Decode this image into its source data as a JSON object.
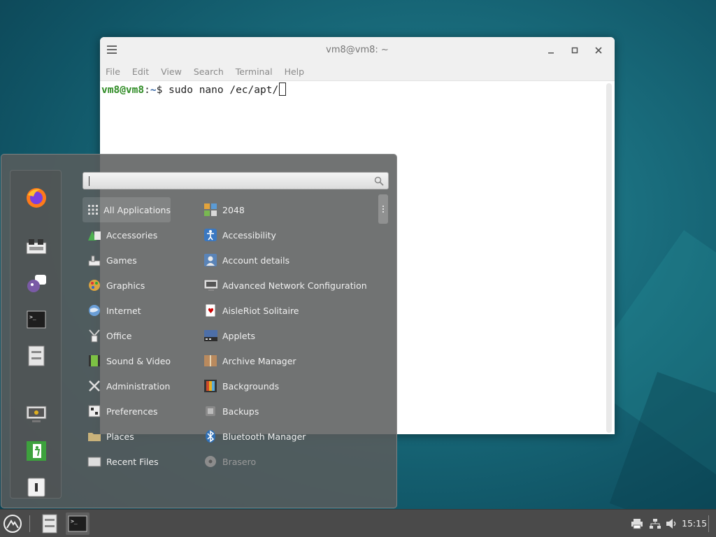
{
  "terminal": {
    "title": "vm8@vm8: ~",
    "menu": [
      "File",
      "Edit",
      "View",
      "Search",
      "Terminal",
      "Help"
    ],
    "prompt_user": "vm8@vm8",
    "prompt_sep": ":",
    "prompt_path": "~",
    "prompt_symbol": "$",
    "command": " sudo nano /ec/apt/"
  },
  "menu": {
    "search_value": "",
    "favorites": [
      "firefox-icon",
      "software-manager-icon",
      "pidgin-icon",
      "terminal-icon",
      "files-icon"
    ],
    "session": [
      "lock-screen-icon",
      "logout-icon",
      "shutdown-icon"
    ],
    "categories": [
      {
        "label": "All Applications",
        "icon": "grid-icon"
      },
      {
        "label": "Accessories",
        "icon": "accessories-icon"
      },
      {
        "label": "Games",
        "icon": "games-icon"
      },
      {
        "label": "Graphics",
        "icon": "graphics-icon"
      },
      {
        "label": "Internet",
        "icon": "internet-icon"
      },
      {
        "label": "Office",
        "icon": "office-icon"
      },
      {
        "label": "Sound & Video",
        "icon": "sound-video-icon"
      },
      {
        "label": "Administration",
        "icon": "administration-icon"
      },
      {
        "label": "Preferences",
        "icon": "preferences-icon"
      },
      {
        "label": "Places",
        "icon": "folder-icon"
      },
      {
        "label": "Recent Files",
        "icon": "recent-files-icon"
      }
    ],
    "apps": [
      {
        "label": "2048",
        "icon": "2048-icon"
      },
      {
        "label": "Accessibility",
        "icon": "accessibility-icon"
      },
      {
        "label": "Account details",
        "icon": "account-icon"
      },
      {
        "label": "Advanced Network Configuration",
        "icon": "network-config-icon"
      },
      {
        "label": "AisleRiot Solitaire",
        "icon": "solitaire-icon"
      },
      {
        "label": "Applets",
        "icon": "applets-icon"
      },
      {
        "label": "Archive Manager",
        "icon": "archive-icon"
      },
      {
        "label": "Backgrounds",
        "icon": "backgrounds-icon"
      },
      {
        "label": "Backups",
        "icon": "backups-icon"
      },
      {
        "label": "Bluetooth Manager",
        "icon": "bluetooth-icon"
      },
      {
        "label": "Brasero",
        "icon": "brasero-icon"
      }
    ]
  },
  "taskbar": {
    "clock": "15:15",
    "items": [
      "menu-icon",
      "files-icon",
      "terminal-icon"
    ],
    "tray": [
      "printer-icon",
      "network-icon",
      "volume-icon"
    ]
  }
}
